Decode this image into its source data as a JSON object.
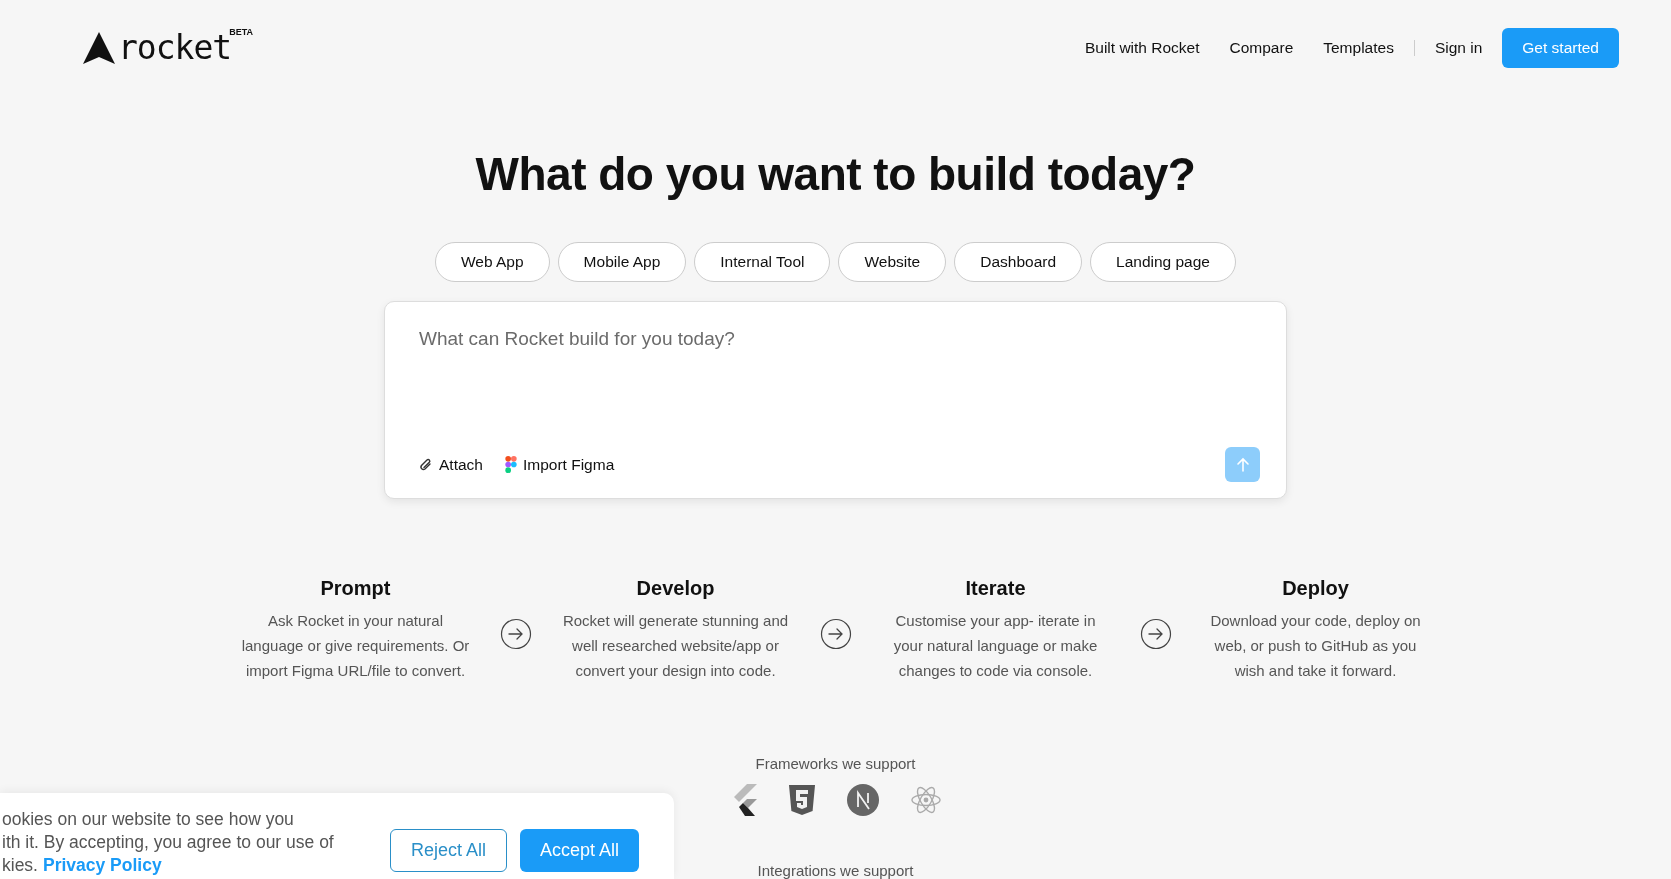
{
  "header": {
    "logo": "rocket",
    "badge": "BETA",
    "nav": [
      "Built with Rocket",
      "Compare",
      "Templates"
    ],
    "sign_in": "Sign in",
    "cta": "Get started"
  },
  "hero": {
    "title": "What do you want to build today?",
    "chips": [
      "Web App",
      "Mobile App",
      "Internal Tool",
      "Website",
      "Dashboard",
      "Landing page"
    ]
  },
  "prompt": {
    "placeholder": "What can Rocket build for you today?",
    "actions": [
      {
        "label": "Attach",
        "kind": "attach"
      },
      {
        "label": "Import Figma",
        "kind": "figma"
      }
    ],
    "send_disabled": true
  },
  "steps": [
    {
      "title": "Prompt",
      "text": "Ask Rocket in your natural language or give requirements. Or import Figma URL/file to convert."
    },
    {
      "title": "Develop",
      "text": "Rocket will generate stunning and well researched website/app or convert your design into code."
    },
    {
      "title": "Iterate",
      "text": "Customise your app- iterate in your natural language or make changes to code via console."
    },
    {
      "title": "Deploy",
      "text": "Download your code, deploy on web, or push to GitHub as you wish and take it forward."
    }
  ],
  "frameworks_label": "Frameworks we support",
  "integrations_label": "Integrations we support",
  "cookie": {
    "lines": [
      "ookies on our website to see how you",
      "ith it. By accepting, you agree to our use of"
    ],
    "tail": "kies.",
    "link": "Privacy Policy",
    "reject": "Reject All",
    "accept": "Accept All"
  }
}
